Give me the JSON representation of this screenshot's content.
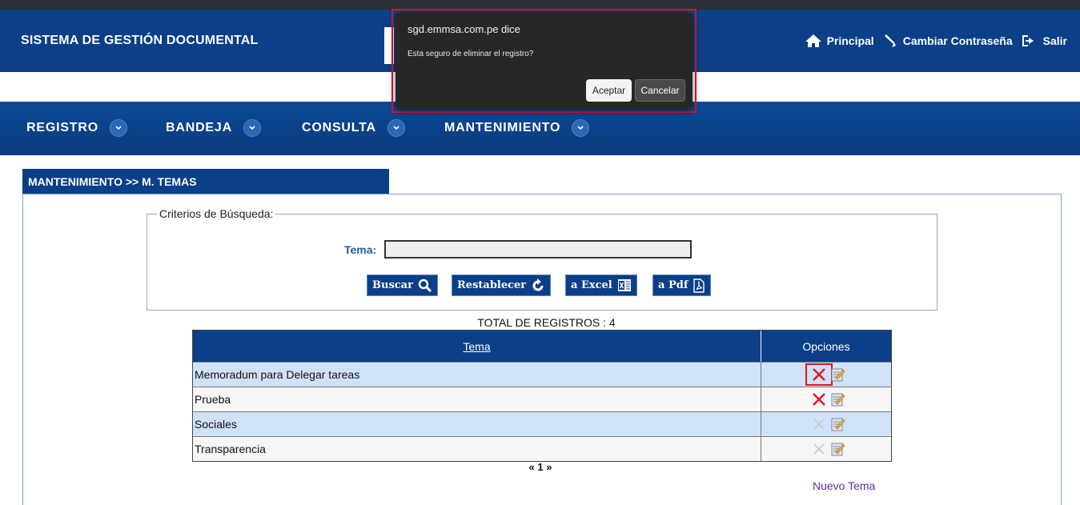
{
  "header": {
    "title": "SISTEMA DE GESTIÓN DOCUMENTAL",
    "links": {
      "principal": "Principal",
      "cambiar": "Cambiar Contraseña",
      "salir": "Salir"
    }
  },
  "menu": {
    "registro": "REGISTRO",
    "bandeja": "BANDEJA",
    "consulta": "CONSULTA",
    "mantenimiento": "MANTENIMIENTO"
  },
  "breadcrumb": "MANTENIMIENTO >> M. TEMAS",
  "search": {
    "legend": "Criterios de Búsqueda:",
    "tema_label": "Tema:",
    "tema_value": "",
    "buttons": {
      "buscar": "Buscar",
      "restablecer": "Restablecer",
      "excel": "a Excel",
      "pdf": "a Pdf"
    }
  },
  "total": "TOTAL DE REGISTROS : 4",
  "grid": {
    "headers": {
      "tema": "Tema",
      "opciones": "Opciones"
    },
    "rows": [
      {
        "tema": "Memoradum para Delegar tareas",
        "delete_enabled": true
      },
      {
        "tema": "Prueba",
        "delete_enabled": true
      },
      {
        "tema": "Sociales",
        "delete_enabled": false
      },
      {
        "tema": "Transparencia",
        "delete_enabled": false
      }
    ]
  },
  "pager": "« 1 »",
  "new_link": "Nuevo Tema",
  "dialog": {
    "host": "sgd.emmsa.com.pe dice",
    "message": "Esta seguro de eliminar el registro?",
    "ok": "Aceptar",
    "cancel": "Cancelar"
  },
  "colors": {
    "brand_blue": "#0b3f87",
    "row_alt": "#cfe2f8",
    "delete_red": "#e0161f"
  }
}
